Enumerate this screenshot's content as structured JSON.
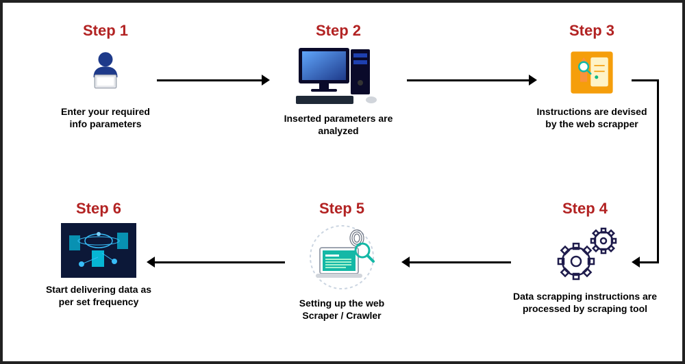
{
  "steps": [
    {
      "title": "Step 1",
      "caption_line1": "Enter your required",
      "caption_line2": "info parameters",
      "icon": "person-laptop-icon"
    },
    {
      "title": "Step 2",
      "caption_line1": "Inserted parameters are",
      "caption_line2": "analyzed",
      "icon": "desktop-computer-icon"
    },
    {
      "title": "Step 3",
      "caption_line1": "Instructions are devised",
      "caption_line2": "by the web scrapper",
      "icon": "clipboard-search-icon"
    },
    {
      "title": "Step 4",
      "caption_line1": "Data scrapping instructions are",
      "caption_line2": "processed by scraping tool",
      "icon": "gears-icon"
    },
    {
      "title": "Step 5",
      "caption_line1": "Setting up the web",
      "caption_line2": "Scraper / Crawler",
      "icon": "laptop-fingerprint-icon"
    },
    {
      "title": "Step 6",
      "caption_line1": "Start delivering data as",
      "caption_line2": "per set frequency",
      "icon": "data-network-icon"
    }
  ],
  "colors": {
    "title": "#b22222",
    "computer_blue": "#1e3a8a",
    "teal": "#14b8a6",
    "orange": "#f59e0b",
    "navy": "#1e3a8a"
  }
}
